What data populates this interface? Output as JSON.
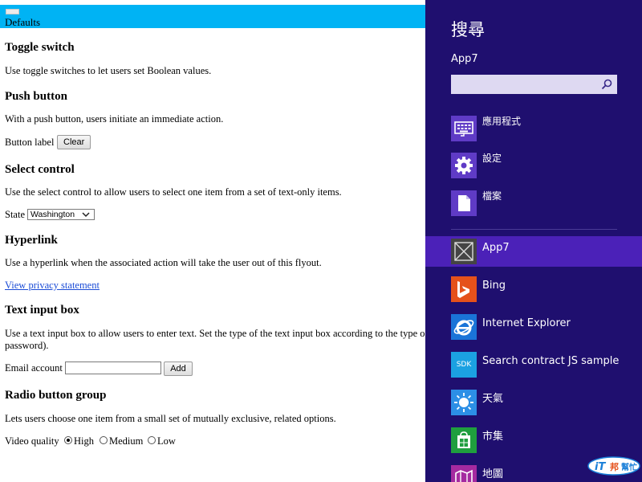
{
  "app": {
    "header": {
      "title": "Defaults"
    },
    "toggle": {
      "title": "Toggle switch",
      "description": "Use toggle switches to let users set Boolean values."
    },
    "push_button": {
      "title": "Push button",
      "description": "With a push button, users initiate an immediate action.",
      "field_label": "Button label",
      "button_label": "Clear"
    },
    "select": {
      "title": "Select control",
      "description": "Use the select control to allow users to select one item from a set of text-only items.",
      "field_label": "State",
      "selected_value": "Washington"
    },
    "hyperlink": {
      "title": "Hyperlink",
      "description": "Use a hyperlink when the associated action will take the user out of this flyout.",
      "link_text": "View privacy statement"
    },
    "text_input": {
      "title": "Text input box",
      "description": "Use a text input box to allow users to enter text. Set the type of the text input box according to the type o",
      "description_cont": "password).",
      "field_label": "Email account",
      "value": "",
      "button_label": "Add"
    },
    "radio": {
      "title": "Radio button group",
      "description": "Lets users choose one item from a small set of mutually exclusive, related options.",
      "field_label": "Video quality",
      "options": [
        {
          "label": "High",
          "selected": true
        },
        {
          "label": "Medium",
          "selected": false
        },
        {
          "label": "Low",
          "selected": false
        }
      ]
    }
  },
  "charm": {
    "heading": "搜尋",
    "context_app": "App7",
    "search_value": "",
    "scopes": [
      {
        "label": "應用程式",
        "icon": "keyboard-icon"
      },
      {
        "label": "設定",
        "icon": "gear-icon"
      },
      {
        "label": "檔案",
        "icon": "document-icon"
      }
    ],
    "apps": [
      {
        "label": "App7",
        "icon": "placeholder-x-icon",
        "selected": true
      },
      {
        "label": "Bing",
        "icon": "bing-icon"
      },
      {
        "label": "Internet Explorer",
        "icon": "ie-icon"
      },
      {
        "label": "Search contract JS sample",
        "icon": "sdk-icon"
      },
      {
        "label": "天氣",
        "icon": "weather-icon"
      },
      {
        "label": "市集",
        "icon": "store-icon"
      },
      {
        "label": "地圖",
        "icon": "maps-icon"
      }
    ],
    "sdk_icon_text": "SDK"
  },
  "watermark": {
    "text": "iT邦幫忙"
  },
  "colors": {
    "accent_bar": "#00b3f4",
    "charm_bg": "#1f0f6f",
    "charm_selected": "#4b21b8",
    "scope_icon_bg": "#5f3bc6",
    "link": "#1a4bd6"
  }
}
